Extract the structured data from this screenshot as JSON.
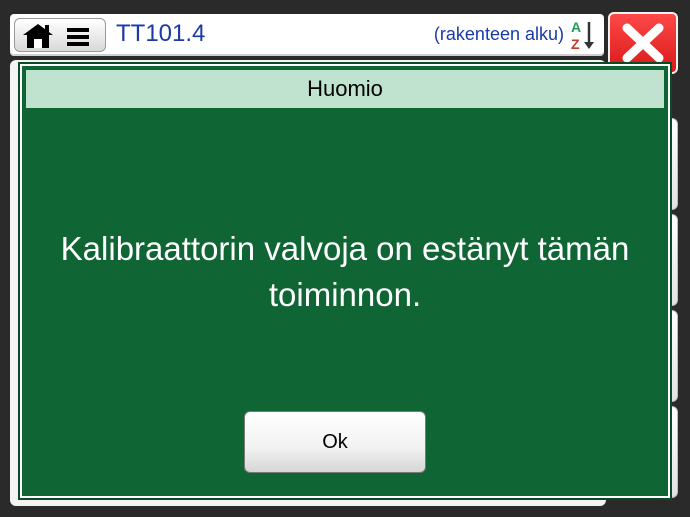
{
  "header": {
    "tag": "TT101.4",
    "structure_label": "(rakenteen alku)"
  },
  "dialog": {
    "title": "Huomio",
    "message": "Kalibraattorin valvoja on estänyt tämän toiminnon.",
    "ok_label": "Ok"
  },
  "colors": {
    "dialog_bg": "#0f6534",
    "dialog_title_bg": "#bfe3cf",
    "header_text": "#1a3aa8",
    "close_button": "#e02020"
  },
  "icons": [
    "home-icon",
    "menu-icon",
    "sort-az-icon",
    "close-icon"
  ]
}
